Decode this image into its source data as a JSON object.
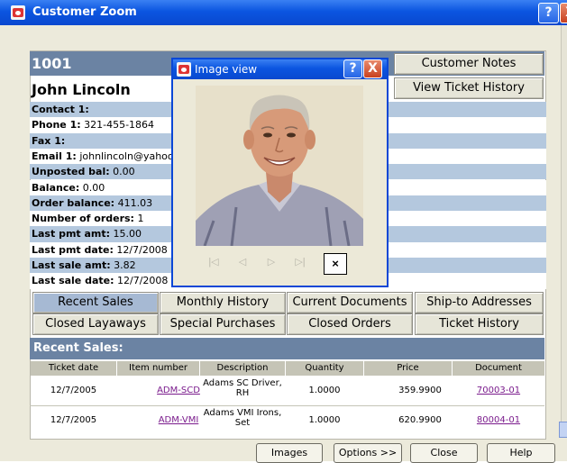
{
  "window": {
    "title": "Customer Zoom",
    "help_glyph": "?",
    "close_glyph": "X"
  },
  "customer": {
    "id": "1001",
    "name": "John Lincoln",
    "fields": [
      {
        "label": "Contact 1:",
        "value": ""
      },
      {
        "label": "Phone 1:",
        "value": "321-455-1864"
      },
      {
        "label": "Fax 1:",
        "value": ""
      },
      {
        "label": "Email 1:",
        "value": "johnlincoln@yahoo.com"
      },
      {
        "label": "Unposted bal:",
        "value": "0.00"
      },
      {
        "label": "Balance:",
        "value": "0.00"
      },
      {
        "label": "Order balance:",
        "value": "411.03"
      },
      {
        "label": "Number of orders:",
        "value": "1"
      },
      {
        "label": "Last pmt amt:",
        "value": "15.00"
      },
      {
        "label": "Last pmt date:",
        "value": "12/7/2008"
      },
      {
        "label": "Last sale amt:",
        "value": "3.82"
      },
      {
        "label": "Last sale date:",
        "value": "12/7/2008"
      }
    ]
  },
  "side_buttons": {
    "notes": "Customer Notes",
    "history": "View Ticket History"
  },
  "tabs": {
    "row1": [
      "Recent Sales",
      "Monthly History",
      "Current Documents",
      "Ship-to Addresses"
    ],
    "row2": [
      "Closed Layaways",
      "Special Purchases",
      "Closed Orders",
      "Ticket History"
    ]
  },
  "section_title": "Recent Sales:",
  "table": {
    "headers": [
      "Ticket date",
      "Item number",
      "Description",
      "Quantity",
      "Price",
      "Document"
    ],
    "rows": [
      {
        "date": "12/7/2005",
        "item": "ADM-SCD",
        "desc1": "Adams SC Driver,",
        "desc2": "RH",
        "qty": "1.0000",
        "price": "359.9900",
        "doc": "70003-01"
      },
      {
        "date": "12/7/2005",
        "item": "ADM-VMI",
        "desc1": "Adams VMI Irons,",
        "desc2": "Set",
        "qty": "1.0000",
        "price": "620.9900",
        "doc": "80004-01"
      }
    ]
  },
  "bottom": {
    "images": "Images",
    "options": "Options >>",
    "close": "Close",
    "help": "Help"
  },
  "dialog": {
    "title": "Image view",
    "help_glyph": "?",
    "close_glyph": "X",
    "nav": [
      "|◁",
      "◁",
      "▷",
      "▷|"
    ],
    "x_glyph": "×"
  },
  "colors": {
    "header_blue": "#6b83a3",
    "row_blue": "#b4c8de",
    "link_purple": "#7a1b8c",
    "title_blue": "#0b55e0"
  }
}
